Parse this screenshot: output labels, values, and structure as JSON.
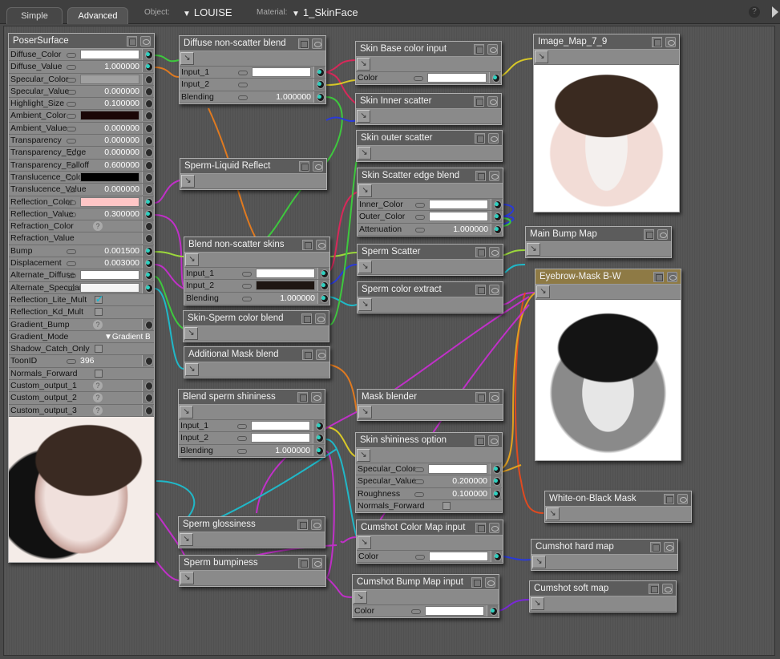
{
  "toolbar": {
    "tabs": [
      {
        "label": "Simple",
        "active": false
      },
      {
        "label": "Advanced",
        "active": true
      }
    ],
    "object_label": "Object:",
    "object_value": "LOUISE",
    "material_label": "Material:",
    "material_value": "1_SkinFace",
    "help_icon": "?"
  },
  "root": {
    "title": "PoserSurface",
    "params": [
      {
        "name": "Diffuse_Color",
        "type": "color",
        "color": "#ffffff",
        "connected": true
      },
      {
        "name": "Diffuse_Value",
        "type": "value",
        "value": "1.000000",
        "connected": true
      },
      {
        "name": "Specular_Color",
        "type": "color",
        "color": "#a0a0a0",
        "connected": false
      },
      {
        "name": "Specular_Value",
        "type": "value",
        "value": "0.000000",
        "connected": false
      },
      {
        "name": "Highlight_Size",
        "type": "value",
        "value": "0.100000",
        "connected": false
      },
      {
        "name": "Ambient_Color",
        "type": "color",
        "color": "#1a0606",
        "connected": false
      },
      {
        "name": "Ambient_Value",
        "type": "value",
        "value": "0.000000",
        "connected": false
      },
      {
        "name": "Transparency",
        "type": "value",
        "value": "0.000000",
        "connected": false
      },
      {
        "name": "Transparency_Edge",
        "type": "value",
        "value": "0.000000",
        "connected": false
      },
      {
        "name": "Transparency_Falloff",
        "type": "value",
        "value": "0.600000",
        "connected": false
      },
      {
        "name": "Translucence_Color",
        "type": "color",
        "color": "#000000",
        "connected": false
      },
      {
        "name": "Translucence_Value",
        "type": "value",
        "value": "0.000000",
        "connected": false
      },
      {
        "name": "Reflection_Color",
        "type": "color",
        "color": "#ffc6c6",
        "connected": true
      },
      {
        "name": "Reflection_Value",
        "type": "value",
        "value": "0.300000",
        "connected": true
      },
      {
        "name": "Refraction_Color",
        "type": "help",
        "connected": false
      },
      {
        "name": "Refraction_Value",
        "type": "none",
        "connected": false
      },
      {
        "name": "Bump",
        "type": "value",
        "value": "0.001500",
        "connected": true
      },
      {
        "name": "Displacement",
        "type": "value",
        "value": "0.003000",
        "connected": true
      },
      {
        "name": "Alternate_Diffuse",
        "type": "color",
        "color": "#ffffff",
        "connected": true
      },
      {
        "name": "Alternate_Specular",
        "type": "color",
        "color": "#f4f4f4",
        "connected": true
      },
      {
        "name": "Reflection_Lite_Mult",
        "type": "check",
        "checked": true
      },
      {
        "name": "Reflection_Kd_Mult",
        "type": "check",
        "checked": false
      },
      {
        "name": "Gradient_Bump",
        "type": "help",
        "connected": false
      },
      {
        "name": "Gradient_Mode",
        "type": "dropdown",
        "value": "Gradient B"
      },
      {
        "name": "Shadow_Catch_Only",
        "type": "check",
        "checked": false
      },
      {
        "name": "ToonID",
        "type": "int",
        "value": "396",
        "connected": false
      },
      {
        "name": "Normals_Forward",
        "type": "check",
        "checked": false
      },
      {
        "name": "Custom_output_1",
        "type": "help",
        "connected": false
      },
      {
        "name": "Custom_output_2",
        "type": "help",
        "connected": false
      },
      {
        "name": "Custom_output_3",
        "type": "help",
        "connected": false
      }
    ]
  },
  "nodes": [
    {
      "id": "diffuse-non-scatter-blend",
      "title": "Diffuse non-scatter blend",
      "params": [
        {
          "name": "Input_1",
          "type": "color",
          "color": "#ffffff"
        },
        {
          "name": "Input_2",
          "type": "none"
        },
        {
          "name": "Blending",
          "type": "value",
          "value": "1.000000"
        }
      ]
    },
    {
      "id": "sperm-liquid-reflect",
      "title": "Sperm-Liquid Reflect",
      "params": []
    },
    {
      "id": "blend-non-scatter-skins",
      "title": "Blend non-scatter skins",
      "params": [
        {
          "name": "Input_1",
          "type": "color",
          "color": "#ffffff"
        },
        {
          "name": "Input_2",
          "type": "color",
          "color": "#1e1612"
        },
        {
          "name": "Blending",
          "type": "value",
          "value": "1.000000"
        }
      ]
    },
    {
      "id": "skin-sperm-color-blend",
      "title": "Skin-Sperm color blend",
      "params": []
    },
    {
      "id": "additional-mask-blend",
      "title": "Additional Mask blend",
      "params": []
    },
    {
      "id": "blend-sperm-shininess",
      "title": "Blend sperm shininess",
      "params": [
        {
          "name": "Input_1",
          "type": "color",
          "color": "#ffffff"
        },
        {
          "name": "Input_2",
          "type": "color",
          "color": "#ffffff"
        },
        {
          "name": "Blending",
          "type": "value",
          "value": "1.000000"
        }
      ]
    },
    {
      "id": "sperm-glossiness",
      "title": "Sperm glossiness",
      "params": []
    },
    {
      "id": "sperm-bumpiness",
      "title": "Sperm bumpiness",
      "params": []
    },
    {
      "id": "skin-base-color-input",
      "title": "Skin Base color input",
      "params": [
        {
          "name": "Color",
          "type": "color",
          "color": "#ffffff"
        }
      ]
    },
    {
      "id": "skin-inner-scatter",
      "title": "Skin Inner scatter",
      "params": []
    },
    {
      "id": "skin-outer-scatter",
      "title": "Skin outer scatter",
      "params": []
    },
    {
      "id": "skin-scatter-edge-blend",
      "title": "Skin Scatter edge blend",
      "params": [
        {
          "name": "Inner_Color",
          "type": "color",
          "color": "#ffffff"
        },
        {
          "name": "Outer_Color",
          "type": "color",
          "color": "#ffffff"
        },
        {
          "name": "Attenuation",
          "type": "value",
          "value": "1.000000"
        }
      ]
    },
    {
      "id": "sperm-scatter",
      "title": "Sperm Scatter",
      "params": []
    },
    {
      "id": "sperm-color-extract",
      "title": "Sperm color extract",
      "params": []
    },
    {
      "id": "mask-blender",
      "title": "Mask blender",
      "params": []
    },
    {
      "id": "skin-shininess-option",
      "title": "Skin shininess option",
      "params": [
        {
          "name": "Specular_Color",
          "type": "color",
          "color": "#ffffff"
        },
        {
          "name": "Specular_Value",
          "type": "value",
          "value": "0.200000"
        },
        {
          "name": "Roughness",
          "type": "value",
          "value": "0.100000"
        },
        {
          "name": "Normals_Forward",
          "type": "check",
          "checked": false
        }
      ]
    },
    {
      "id": "cumshot-color-map-input",
      "title": "Cumshot Color Map input",
      "params": [
        {
          "name": "Color",
          "type": "color",
          "color": "#ffffff"
        }
      ]
    },
    {
      "id": "cumshot-bump-map-input",
      "title": "Cumshot Bump Map input",
      "params": [
        {
          "name": "Color",
          "type": "color",
          "color": "#ffffff"
        }
      ]
    },
    {
      "id": "image-map-7-9",
      "title": "Image_Map_7_9",
      "params": []
    },
    {
      "id": "main-bump-map",
      "title": "Main Bump Map",
      "params": []
    },
    {
      "id": "eyebrow-mask-bw",
      "title": "Eyebrow-Mask B-W",
      "params": []
    },
    {
      "id": "white-on-black-mask",
      "title": "White-on-Black Mask",
      "params": []
    },
    {
      "id": "cumshot-hard-map",
      "title": "Cumshot hard map",
      "params": []
    },
    {
      "id": "cumshot-soft-map",
      "title": "Cumshot soft map",
      "params": []
    }
  ],
  "wire_colors": {
    "green": "#3ec83e",
    "orange": "#e07a20",
    "magenta": "#c030c8",
    "crimson": "#d8285a",
    "yellow": "#d8c828",
    "blue": "#2a3ad8",
    "cyan": "#20b8c8",
    "lime": "#9cd83c",
    "purple": "#7a28d8",
    "red": "#e04a20",
    "gold": "#e0a020"
  }
}
